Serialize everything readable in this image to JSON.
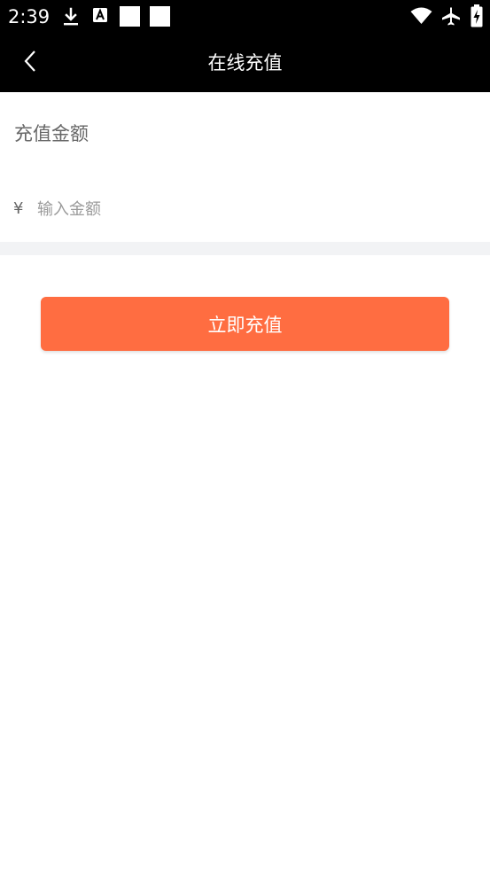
{
  "status_bar": {
    "time": "2:39",
    "left_icons": [
      "download-icon",
      "a-notification-icon",
      "white-square-icon",
      "white-square-icon"
    ],
    "right_icons": [
      "wifi-icon",
      "airplane-icon",
      "battery-charging-icon"
    ]
  },
  "header": {
    "title": "在线充值",
    "back_icon": "chevron-left-icon"
  },
  "recharge": {
    "label": "充值金额",
    "currency": "¥",
    "input_value": "",
    "input_placeholder": "输入金额"
  },
  "actions": {
    "submit_label": "立即充值"
  },
  "colors": {
    "status_bar": "#000000",
    "header": "#000000",
    "primary": "#ff6d41",
    "divider": "#f2f3f5",
    "label_text": "#666666",
    "placeholder_text": "#9a9a9a"
  }
}
